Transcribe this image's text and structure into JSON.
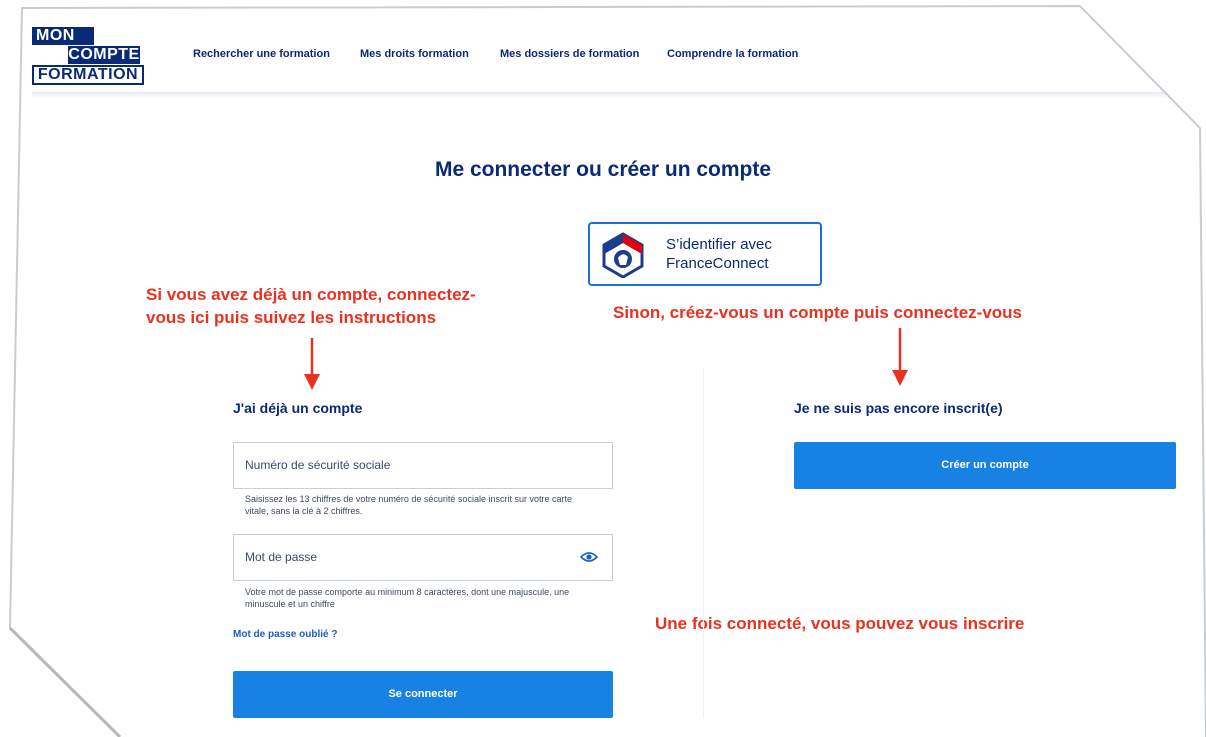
{
  "header": {
    "logo": {
      "line1": "MON",
      "line2": "COMPTE",
      "line3": "FORMATION"
    },
    "nav": [
      {
        "label": "Rechercher une formation"
      },
      {
        "label": "Mes droits formation"
      },
      {
        "label": "Mes dossiers de formation"
      },
      {
        "label": "Comprendre la formation"
      }
    ]
  },
  "page_title": "Me connecter ou créer un compte",
  "franceconnect": {
    "line1": "S’identifier avec",
    "line2": "FranceConnect"
  },
  "annotations": {
    "left_line1": "Si vous avez déjà un compte, connectez-",
    "left_line2": "vous ici puis suivez les instructions",
    "right": "Sinon, créez-vous un compte puis connectez-vous",
    "bottom": "Une fois connecté, vous pouvez vous inscrire",
    "color": "#e8321f"
  },
  "login": {
    "heading": "J'ai déjà un compte",
    "ssn_placeholder": "Numéro de sécurité sociale",
    "ssn_hint_line1": "Saisissez les 13 chiffres de votre numéro de sécurité sociale inscrit sur votre carte",
    "ssn_hint_line2": "vitale, sans la clé à 2 chiffres.",
    "password_placeholder": "Mot de passe",
    "password_hint_line1": "Votre mot de passe comporte au minimum 8 caractères, dont une majuscule, une",
    "password_hint_line2": "minuscule et un chiffre",
    "forgot_link": "Mot de passe oublié ?",
    "submit": "Se connecter"
  },
  "register": {
    "heading": "Je ne suis pas encore inscrit(e)",
    "button": "Créer un compte"
  },
  "icons": [
    "eye-icon",
    "franceconnect-logo",
    "arrow-down-icon"
  ],
  "colors": {
    "navy": "#0a2a75",
    "primary_button": "#1782e4",
    "link": "#1a5fc0"
  }
}
